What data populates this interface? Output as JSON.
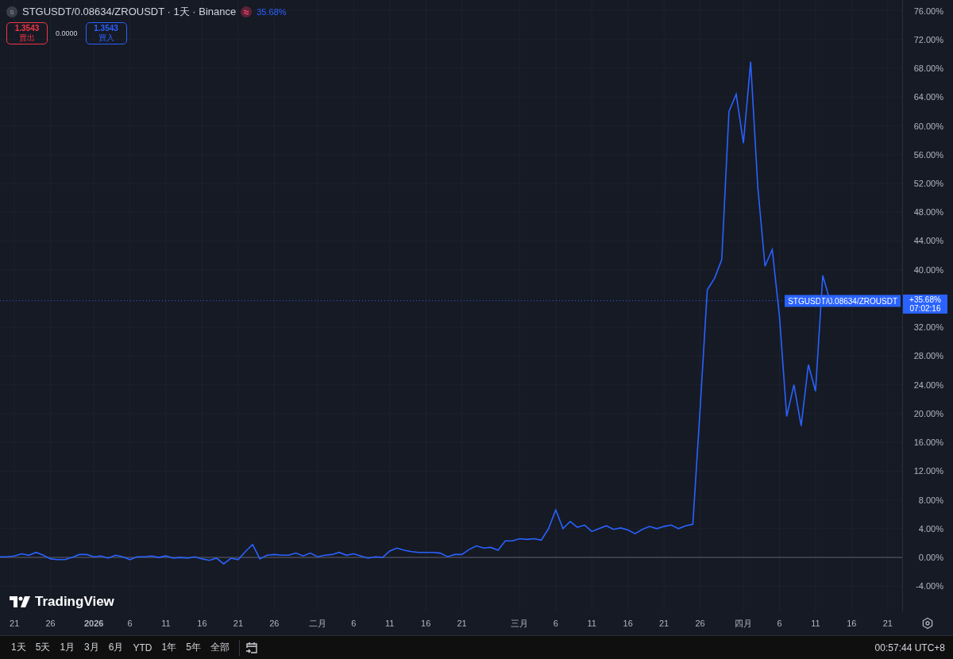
{
  "header": {
    "symbol_letter": "S",
    "title": "STGUSDT/0.08634/ZROUSDT · 1天 · Binance",
    "change": "35.68%"
  },
  "quote": {
    "sell": {
      "price": "1.3543",
      "label": "賣出"
    },
    "spread": "0.0000",
    "buy": {
      "price": "1.3543",
      "label": "買入"
    }
  },
  "chart": {
    "chart_data": {
      "type": "line",
      "x": [
        "2025-12-19",
        "2025-12-20",
        "2025-12-21",
        "2025-12-22",
        "2025-12-23",
        "2025-12-24",
        "2025-12-25",
        "2025-12-26",
        "2025-12-27",
        "2025-12-28",
        "2025-12-29",
        "2025-12-30",
        "2025-12-31",
        "2026-01-01",
        "2026-01-02",
        "2026-01-03",
        "2026-01-04",
        "2026-01-05",
        "2026-01-06",
        "2026-01-07",
        "2026-01-08",
        "2026-01-09",
        "2026-01-10",
        "2026-01-11",
        "2026-01-12",
        "2026-01-13",
        "2026-01-14",
        "2026-01-15",
        "2026-01-16",
        "2026-01-17",
        "2026-01-18",
        "2026-01-19",
        "2026-01-20",
        "2026-01-21",
        "2026-01-22",
        "2026-01-23",
        "2026-01-24",
        "2026-01-25",
        "2026-01-26",
        "2026-01-27",
        "2026-01-28",
        "2026-01-29",
        "2026-01-30",
        "2026-01-31",
        "2026-02-01",
        "2026-02-02",
        "2026-02-03",
        "2026-02-04",
        "2026-02-05",
        "2026-02-06",
        "2026-02-07",
        "2026-02-08",
        "2026-02-09",
        "2026-02-10",
        "2026-02-11",
        "2026-02-12",
        "2026-02-13",
        "2026-02-14",
        "2026-02-15",
        "2026-02-16",
        "2026-02-17",
        "2026-02-18",
        "2026-02-19",
        "2026-02-20",
        "2026-02-21",
        "2026-02-22",
        "2026-02-23",
        "2026-02-24",
        "2026-02-25",
        "2026-02-26",
        "2026-02-27",
        "2026-02-28",
        "2026-03-01",
        "2026-03-02",
        "2026-03-03",
        "2026-03-04",
        "2026-03-05",
        "2026-03-06",
        "2026-03-07",
        "2026-03-08",
        "2026-03-09",
        "2026-03-10",
        "2026-03-11",
        "2026-03-12",
        "2026-03-13",
        "2026-03-14",
        "2026-03-15",
        "2026-03-16",
        "2026-03-17",
        "2026-03-18",
        "2026-03-19",
        "2026-03-20",
        "2026-03-21",
        "2026-03-22",
        "2026-03-23",
        "2026-03-24",
        "2026-03-25",
        "2026-03-26",
        "2026-03-27",
        "2026-03-28",
        "2026-03-29",
        "2026-03-30",
        "2026-03-31",
        "2026-04-01",
        "2026-04-02",
        "2026-04-03",
        "2026-04-04",
        "2026-04-05",
        "2026-04-06",
        "2026-04-07",
        "2026-04-08",
        "2026-04-09",
        "2026-04-10",
        "2026-04-11",
        "2026-04-12",
        "2026-04-13"
      ],
      "series": [
        {
          "name": "STGUSDT/0.08634/ZROUSDT",
          "color": "#2962ff",
          "values": [
            0.1,
            0.1,
            0.2,
            0.5,
            0.3,
            0.7,
            0.3,
            -0.2,
            -0.3,
            -0.3,
            0.0,
            0.4,
            0.4,
            0.1,
            0.2,
            -0.1,
            0.3,
            0.1,
            -0.3,
            0.1,
            0.1,
            0.2,
            0.0,
            0.2,
            -0.1,
            0.0,
            -0.1,
            0.1,
            -0.2,
            -0.4,
            -0.1,
            -0.9,
            -0.1,
            -0.3,
            0.8,
            1.8,
            -0.2,
            0.3,
            0.4,
            0.3,
            0.3,
            0.6,
            0.2,
            0.6,
            0.1,
            0.3,
            0.4,
            0.7,
            0.3,
            0.5,
            0.2,
            -0.1,
            0.1,
            0.0,
            0.9,
            1.3,
            1.0,
            0.8,
            0.7,
            0.7,
            0.7,
            0.6,
            0.1,
            0.4,
            0.4,
            1.1,
            1.6,
            1.3,
            1.4,
            1.0,
            2.3,
            2.3,
            2.6,
            2.5,
            2.6,
            2.4,
            4.0,
            6.6,
            4.0,
            5.0,
            4.2,
            4.5,
            3.6,
            4.0,
            4.4,
            3.9,
            4.1,
            3.8,
            3.3,
            3.9,
            4.3,
            4.0,
            4.3,
            4.5,
            4.0,
            4.4,
            4.6,
            20.5,
            37.2,
            38.8,
            41.4,
            62.0,
            64.4,
            57.6,
            68.9,
            51.5,
            40.5,
            42.8,
            33.5,
            19.6,
            24.0,
            18.3,
            26.8,
            23.1,
            39.2,
            35.7
          ]
        }
      ],
      "xlim": [
        "2025-12-19",
        "2026-04-23"
      ],
      "grid": true,
      "ylim": [
        -7.5,
        77.5
      ],
      "xticks": [
        {
          "value": "2025-12-21",
          "label": "21"
        },
        {
          "value": "2025-12-26",
          "label": "26"
        },
        {
          "value": "2026-01-01",
          "label": "2026"
        },
        {
          "value": "2026-01-06",
          "label": "6"
        },
        {
          "value": "2026-01-11",
          "label": "11"
        },
        {
          "value": "2026-01-16",
          "label": "16"
        },
        {
          "value": "2026-01-21",
          "label": "21"
        },
        {
          "value": "2026-01-26",
          "label": "26"
        },
        {
          "value": "2026-02-01",
          "label": "二月"
        },
        {
          "value": "2026-02-06",
          "label": "6"
        },
        {
          "value": "2026-02-11",
          "label": "11"
        },
        {
          "value": "2026-02-16",
          "label": "16"
        },
        {
          "value": "2026-02-21",
          "label": "21"
        },
        {
          "value": "2026-03-01",
          "label": "三月"
        },
        {
          "value": "2026-03-06",
          "label": "6"
        },
        {
          "value": "2026-03-11",
          "label": "11"
        },
        {
          "value": "2026-03-16",
          "label": "16"
        },
        {
          "value": "2026-03-21",
          "label": "21"
        },
        {
          "value": "2026-03-26",
          "label": "26"
        },
        {
          "value": "2026-04-01",
          "label": "四月"
        },
        {
          "value": "2026-04-06",
          "label": "6"
        },
        {
          "value": "2026-04-11",
          "label": "11"
        },
        {
          "value": "2026-04-16",
          "label": "16"
        },
        {
          "value": "2026-04-21",
          "label": "21"
        }
      ],
      "yticks": [
        {
          "value": -4,
          "label": "-4.00%"
        },
        {
          "value": 0,
          "label": "0.00%"
        },
        {
          "value": 4,
          "label": "4.00%"
        },
        {
          "value": 8,
          "label": "8.00%"
        },
        {
          "value": 12,
          "label": "12.00%"
        },
        {
          "value": 16,
          "label": "16.00%"
        },
        {
          "value": 20,
          "label": "20.00%"
        },
        {
          "value": 24,
          "label": "24.00%"
        },
        {
          "value": 28,
          "label": "28.00%"
        },
        {
          "value": 32,
          "label": "32.00%"
        },
        {
          "value": 40,
          "label": "40.00%"
        },
        {
          "value": 44,
          "label": "44.00%"
        },
        {
          "value": 48,
          "label": "48.00%"
        },
        {
          "value": 52,
          "label": "52.00%"
        },
        {
          "value": 56,
          "label": "56.00%"
        },
        {
          "value": 60,
          "label": "60.00%"
        },
        {
          "value": 64,
          "label": "64.00%"
        },
        {
          "value": 68,
          "label": "68.00%"
        },
        {
          "value": 72,
          "label": "72.00%"
        },
        {
          "value": 76,
          "label": "76.00%"
        }
      ]
    },
    "last_value": {
      "change": "+35.68%",
      "countdown": "07:02:16"
    }
  },
  "brand": "TradingView",
  "ranges": [
    "1天",
    "5天",
    "1月",
    "3月",
    "6月",
    "YTD",
    "1年",
    "5年",
    "全部"
  ],
  "clock": "00:57:44 UTC+8"
}
